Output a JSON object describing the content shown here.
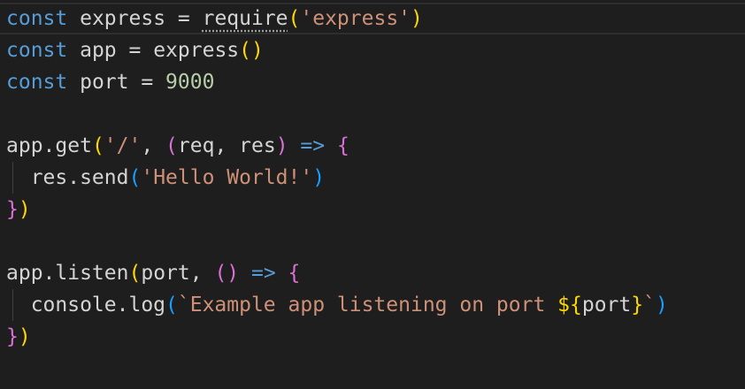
{
  "lines": [
    {
      "tokens": [
        {
          "t": "const",
          "c": "kw"
        },
        {
          "t": " ",
          "c": "sp"
        },
        {
          "t": "express",
          "c": "var"
        },
        {
          "t": " = ",
          "c": "var"
        },
        {
          "t": "require",
          "c": "var"
        },
        {
          "t": "(",
          "c": "p1"
        },
        {
          "t": "'express'",
          "c": "str"
        },
        {
          "t": ")",
          "c": "p1"
        }
      ]
    },
    {
      "tokens": [
        {
          "t": "const",
          "c": "kw"
        },
        {
          "t": " ",
          "c": "sp"
        },
        {
          "t": "app",
          "c": "var"
        },
        {
          "t": " = ",
          "c": "var"
        },
        {
          "t": "express",
          "c": "var"
        },
        {
          "t": "()",
          "c": "p1"
        }
      ]
    },
    {
      "tokens": [
        {
          "t": "const",
          "c": "kw"
        },
        {
          "t": " ",
          "c": "sp"
        },
        {
          "t": "port",
          "c": "var"
        },
        {
          "t": " = ",
          "c": "var"
        },
        {
          "t": "9000",
          "c": "num"
        }
      ]
    },
    {
      "tokens": []
    },
    {
      "tokens": [
        {
          "t": "app.get",
          "c": "var"
        },
        {
          "t": "(",
          "c": "p1"
        },
        {
          "t": "'/'",
          "c": "str"
        },
        {
          "t": ", ",
          "c": "var"
        },
        {
          "t": "(",
          "c": "p2"
        },
        {
          "t": "req",
          "c": "var"
        },
        {
          "t": ", ",
          "c": "var"
        },
        {
          "t": "res",
          "c": "var"
        },
        {
          "t": ")",
          "c": "p2"
        },
        {
          "t": " => ",
          "c": "kw"
        },
        {
          "t": "{",
          "c": "p2"
        }
      ]
    },
    {
      "tokens": [
        {
          "t": "  res.send",
          "c": "var"
        },
        {
          "t": "(",
          "c": "p3"
        },
        {
          "t": "'Hello World!'",
          "c": "str"
        },
        {
          "t": ")",
          "c": "p3"
        }
      ]
    },
    {
      "tokens": [
        {
          "t": "}",
          "c": "p2"
        },
        {
          "t": ")",
          "c": "p1"
        }
      ]
    },
    {
      "tokens": []
    },
    {
      "tokens": [
        {
          "t": "app.listen",
          "c": "var"
        },
        {
          "t": "(",
          "c": "p1"
        },
        {
          "t": "port",
          "c": "var"
        },
        {
          "t": ", ",
          "c": "var"
        },
        {
          "t": "()",
          "c": "p2"
        },
        {
          "t": " => ",
          "c": "kw"
        },
        {
          "t": "{",
          "c": "p2"
        }
      ]
    },
    {
      "tokens": [
        {
          "t": "  console.log",
          "c": "var"
        },
        {
          "t": "(",
          "c": "p3"
        },
        {
          "t": "`Example app listening on port ",
          "c": "str"
        },
        {
          "t": "${",
          "c": "p1"
        },
        {
          "t": "port",
          "c": "var"
        },
        {
          "t": "}",
          "c": "p1"
        },
        {
          "t": "`",
          "c": "str"
        },
        {
          "t": ")",
          "c": "p3"
        }
      ]
    },
    {
      "tokens": [
        {
          "t": "}",
          "c": "p2"
        },
        {
          "t": ")",
          "c": "p1"
        }
      ]
    },
    {
      "tokens": []
    }
  ],
  "colors": {
    "background": "#1e1e1e",
    "keyword": "#569cd6",
    "string": "#ce9178",
    "number": "#b5cea8",
    "bracket_level_1": "#ffd700",
    "bracket_level_2": "#da70d6",
    "bracket_level_3": "#179fff"
  }
}
